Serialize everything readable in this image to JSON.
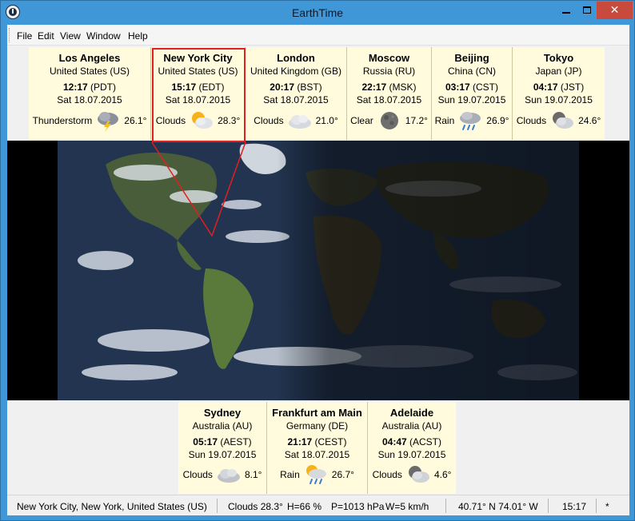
{
  "window": {
    "title": "EarthTime",
    "minimize_glyph": "",
    "maximize_glyph": "",
    "close_glyph": "✕"
  },
  "menu": [
    "File",
    "Edit",
    "View",
    "Window",
    "Help"
  ],
  "cities_top": [
    {
      "city": "Los Angeles",
      "country": "United States (US)",
      "time": "12:17",
      "zone": "(PDT)",
      "date": "Sat 18.07.2015",
      "weather": "Thunderstorm",
      "icon": "thunderstorm-icon",
      "temp": "26.1°"
    },
    {
      "city": "New York City",
      "country": "United States (US)",
      "time": "15:17",
      "zone": "(EDT)",
      "date": "Sat 18.07.2015",
      "weather": "Clouds",
      "icon": "sun-clouds-icon",
      "temp": "28.3°"
    },
    {
      "city": "London",
      "country": "United Kingdom (GB)",
      "time": "20:17",
      "zone": "(BST)",
      "date": "Sat 18.07.2015",
      "weather": "Clouds",
      "icon": "cloud-icon",
      "temp": "21.0°"
    },
    {
      "city": "Moscow",
      "country": "Russia (RU)",
      "time": "22:17",
      "zone": "(MSK)",
      "date": "Sat 18.07.2015",
      "weather": "Clear",
      "icon": "moon-icon",
      "temp": "17.2°"
    },
    {
      "city": "Beijing",
      "country": "China (CN)",
      "time": "03:17",
      "zone": "(CST)",
      "date": "Sun 19.07.2015",
      "weather": "Rain",
      "icon": "rain-icon",
      "temp": "26.9°"
    },
    {
      "city": "Tokyo",
      "country": "Japan (JP)",
      "time": "04:17",
      "zone": "(JST)",
      "date": "Sun 19.07.2015",
      "weather": "Clouds",
      "icon": "moon-clouds-icon",
      "temp": "24.6°"
    }
  ],
  "cities_bottom": [
    {
      "city": "Sydney",
      "country": "Australia (AU)",
      "time": "05:17",
      "zone": "(AEST)",
      "date": "Sun 19.07.2015",
      "weather": "Clouds",
      "icon": "cloud-icon",
      "temp": "8.1°"
    },
    {
      "city": "Frankfurt am Main",
      "country": "Germany (DE)",
      "time": "21:17",
      "zone": "(CEST)",
      "date": "Sat 18.07.2015",
      "weather": "Rain",
      "icon": "sun-rain-icon",
      "temp": "26.7°"
    },
    {
      "city": "Adelaide",
      "country": "Australia (AU)",
      "time": "04:47",
      "zone": "(ACST)",
      "date": "Sun 19.07.2015",
      "weather": "Clouds",
      "icon": "moon-clouds-icon",
      "temp": "4.6°"
    }
  ],
  "status": {
    "location": "New York City, New York, United States (US)",
    "weather": "Clouds 28.3°",
    "humidity": "H=66 %",
    "pressure": "P=1013 hPa",
    "wind": "W=5 km/h",
    "coords": "40.71° N  74.01° W",
    "time": "15:17",
    "flag": "*"
  },
  "colors": {
    "titlebar": "#3f97d8",
    "card_bg": "#fffbdc",
    "highlight": "#e02020",
    "close_button": "#c74a3c"
  }
}
